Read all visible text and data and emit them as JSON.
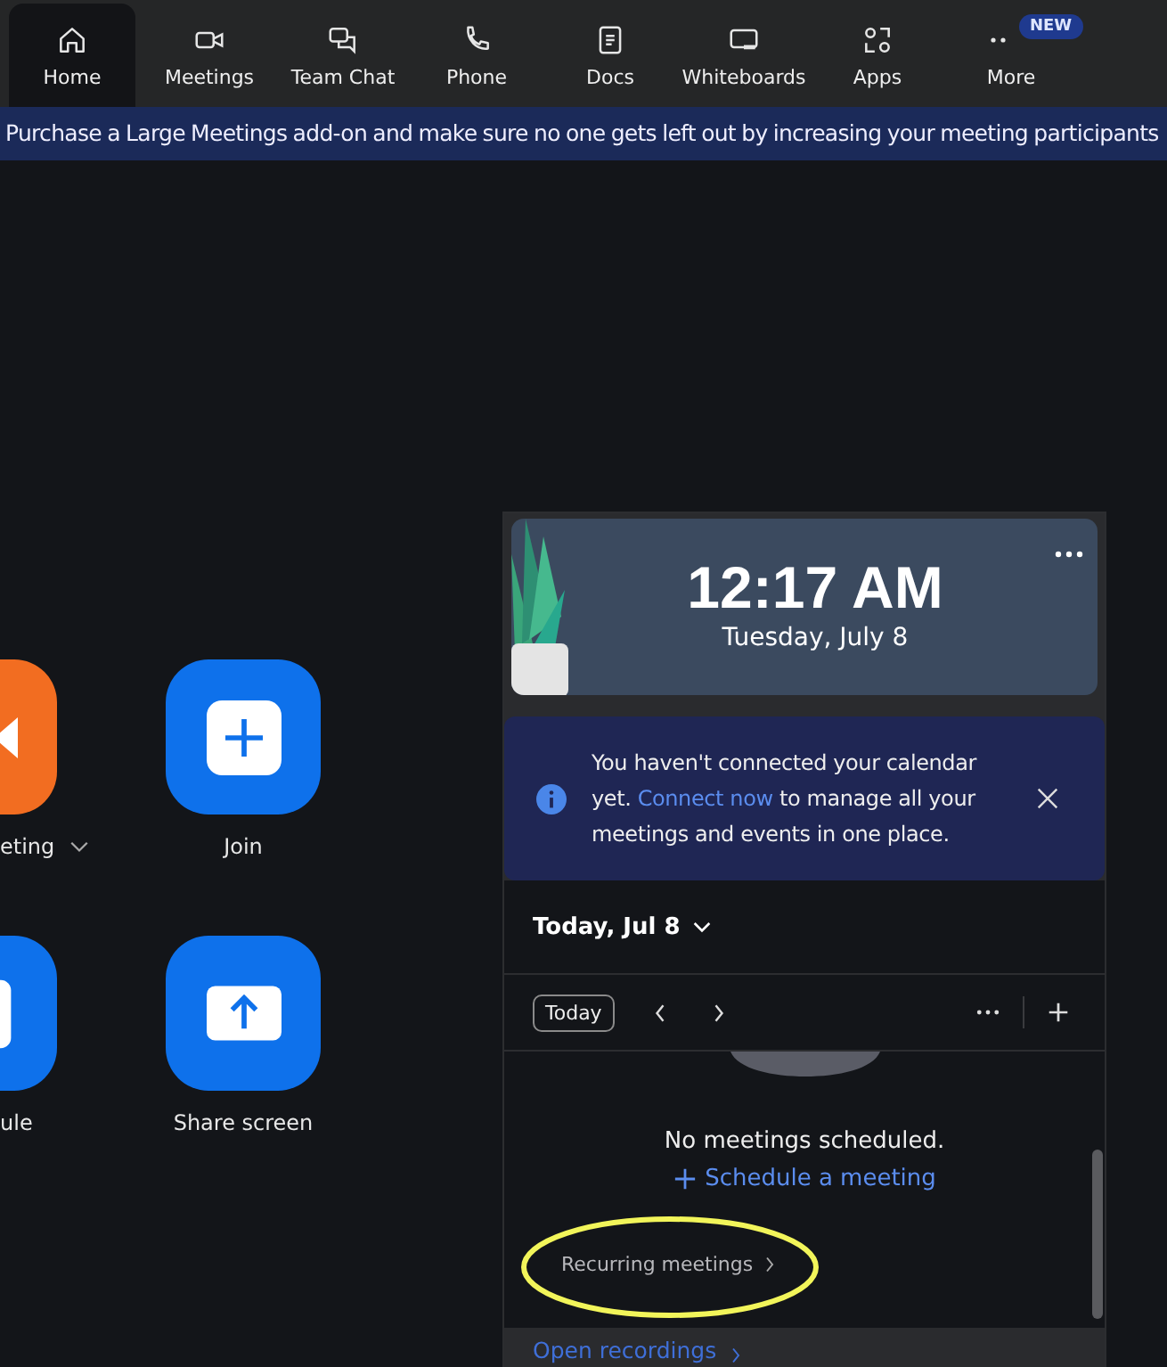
{
  "nav": {
    "tabs": [
      {
        "label": "Home",
        "selected": true
      },
      {
        "label": "Meetings",
        "selected": false
      },
      {
        "label": "Team Chat",
        "selected": false
      },
      {
        "label": "Phone",
        "selected": false
      },
      {
        "label": "Docs",
        "selected": false
      },
      {
        "label": "Whiteboards",
        "selected": false
      },
      {
        "label": "Apps",
        "selected": false
      },
      {
        "label": "More",
        "selected": false,
        "badge": "NEW"
      }
    ]
  },
  "banner": "Purchase a Large Meetings add-on and make sure no one gets left out by increasing your meeting participants",
  "actions": [
    {
      "label": "eting",
      "kind": "video",
      "chevron": true
    },
    {
      "label": "Join",
      "kind": "join",
      "chevron": false
    },
    {
      "label": "ule",
      "kind": "schedule",
      "chevron": false
    },
    {
      "label": "Share screen",
      "kind": "share",
      "chevron": false
    }
  ],
  "clock": {
    "time": "12:17 AM",
    "date": "Tuesday, July 8"
  },
  "notice": {
    "before": "You haven't connected your calendar yet.",
    "link": "Connect now",
    "after": "to manage all your meetings and events in one place."
  },
  "calendar": {
    "heading": "Today, Jul 8",
    "today_button": "Today",
    "empty": "No meetings scheduled.",
    "schedule_link": "Schedule a meeting",
    "recurring": "Recurring meetings",
    "footer_link": "Open recordings"
  }
}
